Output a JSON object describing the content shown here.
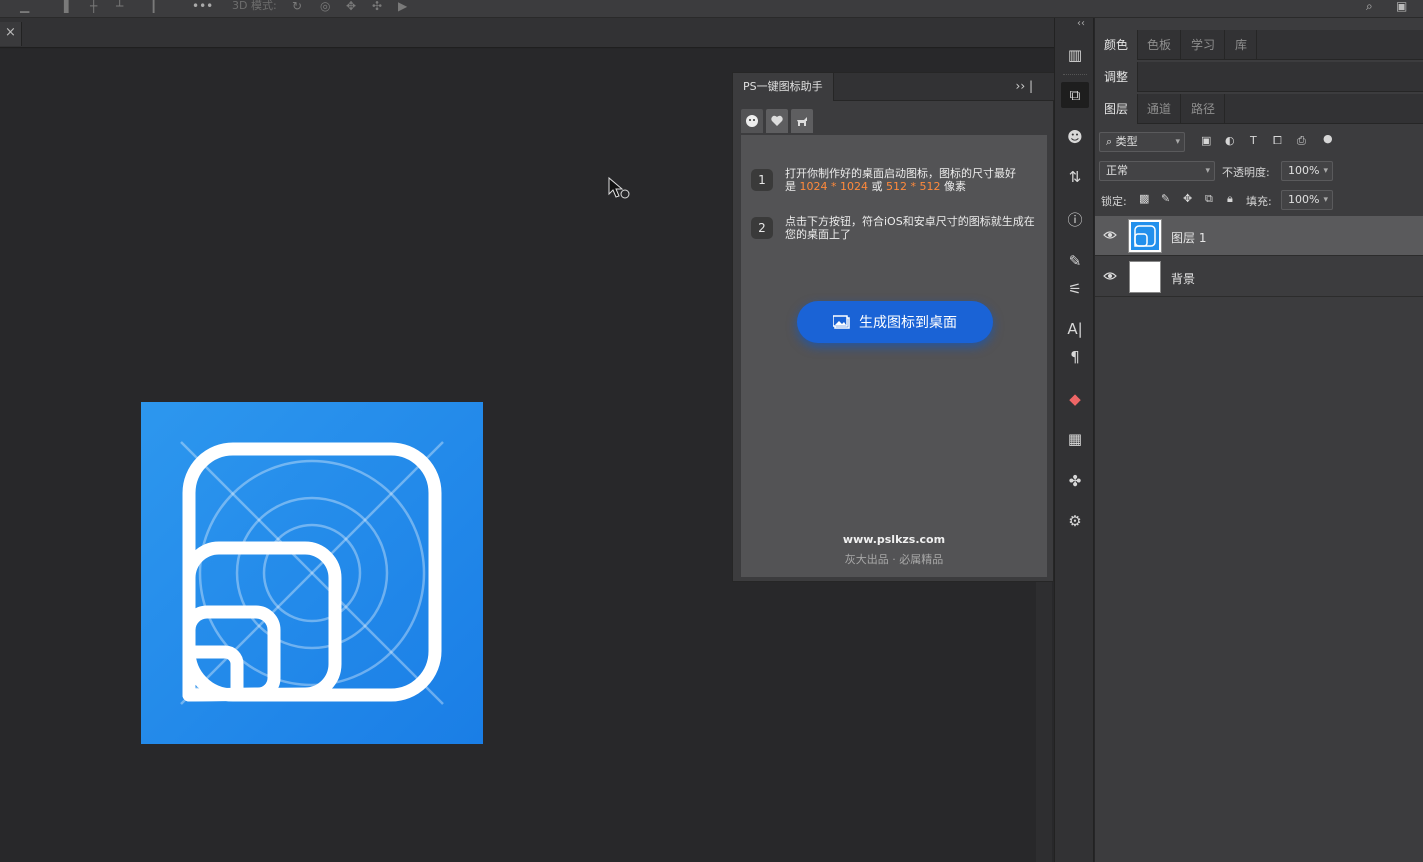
{
  "options_bar": {
    "mode_3d_label": "3D 模式:"
  },
  "plugin": {
    "tab_title": "PS一键图标助手",
    "menu_glyph": "›› |",
    "steps": [
      {
        "num": "1",
        "line1": "打开你制作好的桌面启动图标，图标的尺寸最好",
        "line2_prefix": "是 ",
        "size1": "1024 * 1024",
        "or": " 或 ",
        "size2": "512 * 512",
        "suffix": " 像素"
      },
      {
        "num": "2",
        "text": "点击下方按钮，符合iOS和安卓尺寸的图标就生成在您的桌面上了"
      }
    ],
    "button_label": "生成图标到桌面",
    "site": "www.pslkzs.com",
    "slogan": "灰大出品 · 必属精品"
  },
  "right_panel": {
    "top_tabs": [
      "颜色",
      "色板",
      "学习",
      "库"
    ],
    "adjust_tab": "调整",
    "layer_tabs": [
      "图层",
      "通道",
      "路径"
    ],
    "filter_kind": "类型",
    "blend_mode": "正常",
    "opacity_label": "不透明度:",
    "opacity_value": "100%",
    "lock_label": "锁定:",
    "fill_label": "填充:",
    "fill_value": "100%",
    "layers": [
      {
        "name": "图层 1",
        "selected": true
      },
      {
        "name": "背景",
        "selected": false
      }
    ]
  },
  "colors": {
    "accent_blue": "#1a63d6",
    "icon_blue": "#2290ec",
    "highlight_orange": "#ff8a3c"
  }
}
